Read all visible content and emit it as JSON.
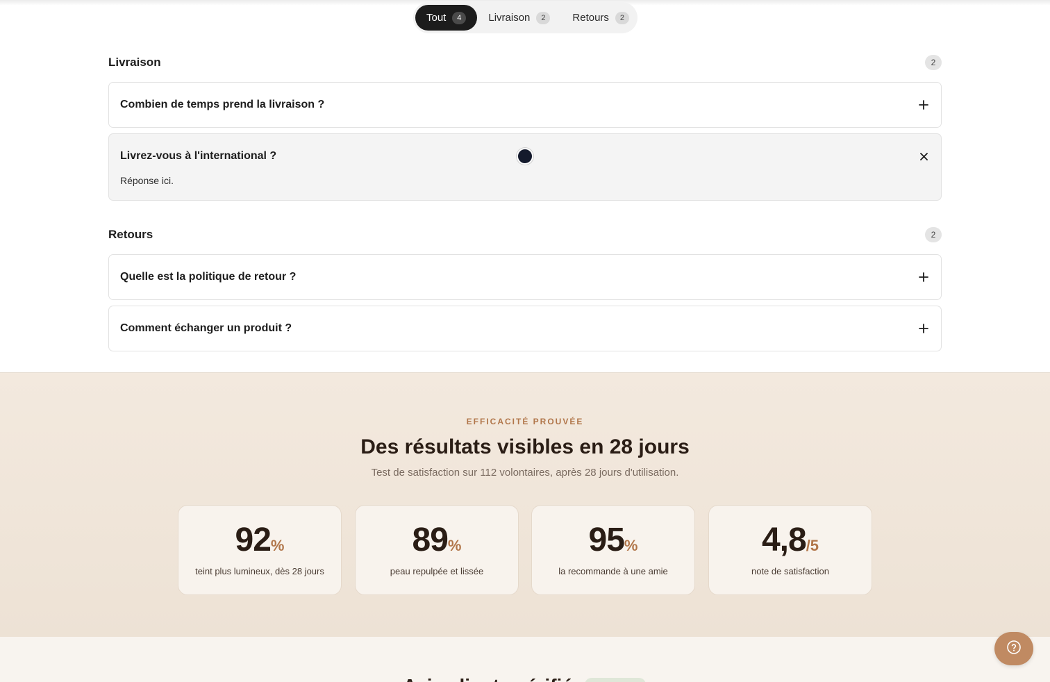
{
  "tabs": [
    {
      "label": "Tout",
      "count": "4",
      "active": true
    },
    {
      "label": "Livraison",
      "count": "2",
      "active": false
    },
    {
      "label": "Retours",
      "count": "2",
      "active": false
    }
  ],
  "groups": [
    {
      "title": "Livraison",
      "count": "2",
      "items": [
        {
          "question": "Combien de temps prend la livraison ?",
          "toggle": "+",
          "open": false
        },
        {
          "question": "Livrez-vous à l'international ?",
          "toggle": "×",
          "open": true,
          "answer": "Réponse ici."
        }
      ]
    },
    {
      "title": "Retours",
      "count": "2",
      "items": [
        {
          "question": "Quelle est la politique de retour ?",
          "toggle": "+",
          "open": false
        },
        {
          "question": "Comment échanger un produit ?",
          "toggle": "+",
          "open": false
        }
      ]
    }
  ],
  "results": {
    "eyebrow": "EFFICACITÉ PROUVÉE",
    "title": "Des résultats visibles en 28 jours",
    "subtitle": "Test de satisfaction sur 112 volontaires, après 28 jours d'utilisation.",
    "stats": [
      {
        "value": "92",
        "unit": "%",
        "label": "teint plus lumineux, dès 28 jours"
      },
      {
        "value": "89",
        "unit": "%",
        "label": "peau repulpée et lissée"
      },
      {
        "value": "95",
        "unit": "%",
        "label": "la recommande à une amie"
      },
      {
        "value": "4,8",
        "unit": "/5",
        "label": "note de satisfaction"
      }
    ]
  },
  "next_section": {
    "title": "Avis clients vérifiés"
  },
  "colors": {
    "accent": "#b1764a",
    "dark": "#1c1c1c",
    "help_button": "#c08a62"
  },
  "icons": {
    "help": "question-circle-icon",
    "expand": "plus-icon",
    "collapse": "close-icon"
  }
}
